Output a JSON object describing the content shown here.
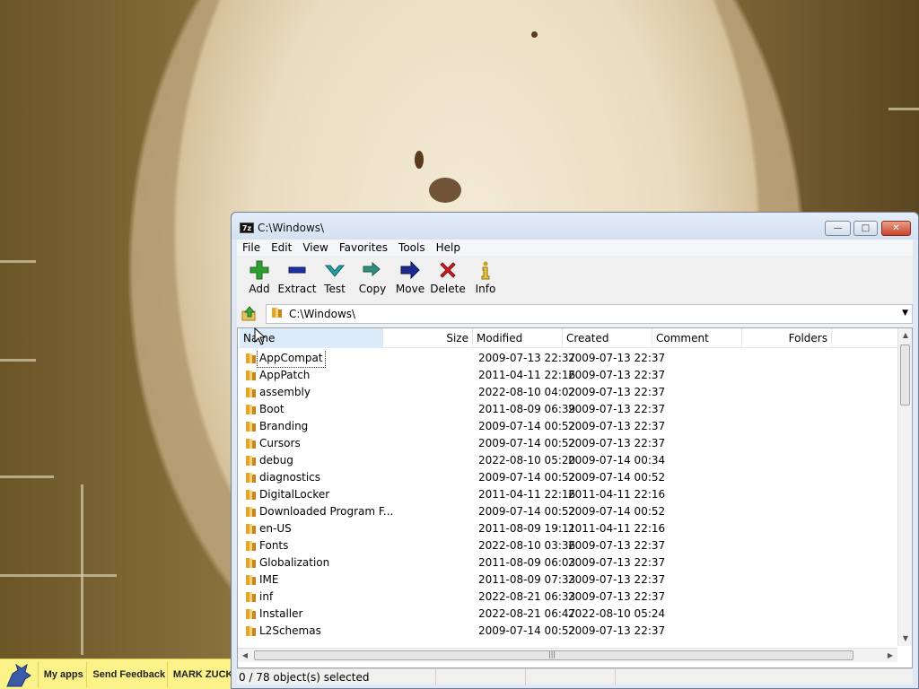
{
  "window": {
    "title": "C:\\Windows\\",
    "app_icon_text": "7z",
    "controls": {
      "minimize": "—",
      "maximize": "□",
      "close": "✕"
    }
  },
  "menu": [
    "File",
    "Edit",
    "View",
    "Favorites",
    "Tools",
    "Help"
  ],
  "toolbar": [
    {
      "label": "Add",
      "icon": "plus-icon",
      "color": "#2e9e2e"
    },
    {
      "label": "Extract",
      "icon": "minus-icon",
      "color": "#1f2fa6"
    },
    {
      "label": "Test",
      "icon": "check-icon",
      "color": "#26a0a8"
    },
    {
      "label": "Copy",
      "icon": "double-arrow-icon",
      "color": "#2f8f7a"
    },
    {
      "label": "Move",
      "icon": "arrow-right-icon",
      "color": "#1b2a8c"
    },
    {
      "label": "Delete",
      "icon": "x-icon",
      "color": "#d42020"
    },
    {
      "label": "Info",
      "icon": "info-icon",
      "color": "#c7a21a"
    }
  ],
  "address": {
    "path": "C:\\Windows\\"
  },
  "columns": {
    "name": "Name",
    "size": "Size",
    "modified": "Modified",
    "created": "Created",
    "comment": "Comment",
    "folders": "Folders"
  },
  "files": [
    {
      "name": "AppCompat",
      "modified": "2009-07-13 22:37",
      "created": "2009-07-13 22:37"
    },
    {
      "name": "AppPatch",
      "modified": "2011-04-11 22:16",
      "created": "2009-07-13 22:37"
    },
    {
      "name": "assembly",
      "modified": "2022-08-10 04:02",
      "created": "2009-07-13 22:37"
    },
    {
      "name": "Boot",
      "modified": "2011-08-09 06:39",
      "created": "2009-07-13 22:37"
    },
    {
      "name": "Branding",
      "modified": "2009-07-14 00:52",
      "created": "2009-07-13 22:37"
    },
    {
      "name": "Cursors",
      "modified": "2009-07-14 00:52",
      "created": "2009-07-13 22:37"
    },
    {
      "name": "debug",
      "modified": "2022-08-10 05:20",
      "created": "2009-07-14 00:34"
    },
    {
      "name": "diagnostics",
      "modified": "2009-07-14 00:52",
      "created": "2009-07-14 00:52"
    },
    {
      "name": "DigitalLocker",
      "modified": "2011-04-11 22:16",
      "created": "2011-04-11 22:16"
    },
    {
      "name": "Downloaded Program F...",
      "modified": "2009-07-14 00:52",
      "created": "2009-07-14 00:52"
    },
    {
      "name": "en-US",
      "modified": "2011-08-09 19:11",
      "created": "2011-04-11 22:16"
    },
    {
      "name": "Fonts",
      "modified": "2022-08-10 03:36",
      "created": "2009-07-13 22:37"
    },
    {
      "name": "Globalization",
      "modified": "2011-08-09 06:03",
      "created": "2009-07-13 22:37"
    },
    {
      "name": "IME",
      "modified": "2011-08-09 07:33",
      "created": "2009-07-13 22:37"
    },
    {
      "name": "inf",
      "modified": "2022-08-21 06:33",
      "created": "2009-07-13 22:37"
    },
    {
      "name": "Installer",
      "modified": "2022-08-21 06:47",
      "created": "2022-08-10 05:24"
    },
    {
      "name": "L2Schemas",
      "modified": "2009-07-14 00:52",
      "created": "2009-07-13 22:37"
    }
  ],
  "status": {
    "selection": "0 / 78 object(s) selected"
  },
  "taskbar": {
    "items": [
      "My apps",
      "Send Feedback",
      "MARK ZUCK"
    ]
  }
}
